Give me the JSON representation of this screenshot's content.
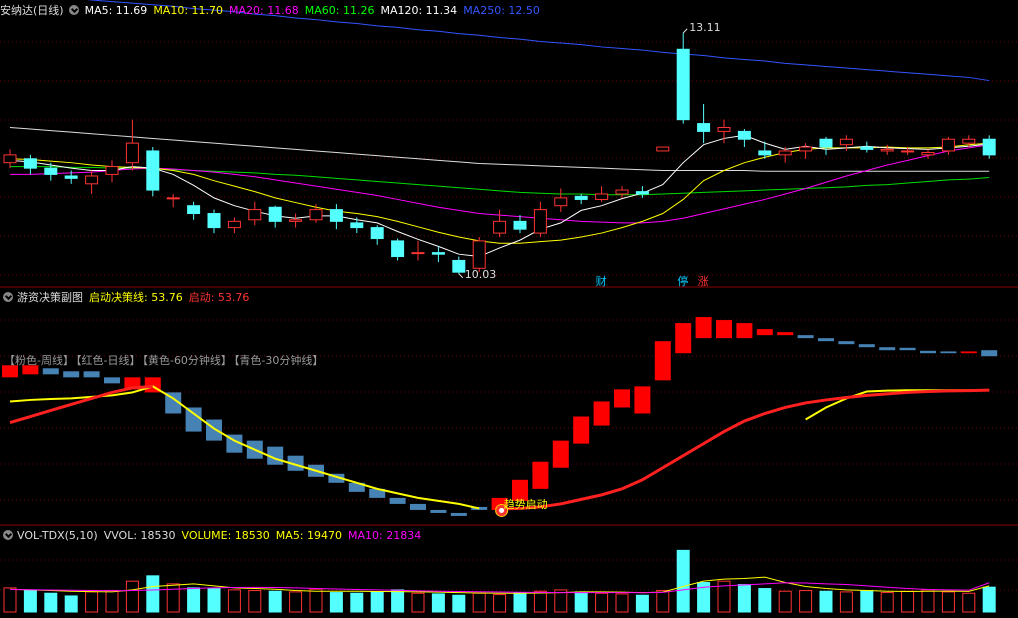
{
  "main": {
    "title": "安纳达(日线)",
    "ma": [
      {
        "label": "MA5: 11.69",
        "color": "#ffffff"
      },
      {
        "label": "MA10: 11.70",
        "color": "#ffff00"
      },
      {
        "label": "MA20: 11.68",
        "color": "#ff00ff"
      },
      {
        "label": "MA60: 11.26",
        "color": "#00ff00"
      },
      {
        "label": "MA120: 11.34",
        "color": "#ffffff"
      },
      {
        "label": "MA250: 12.50",
        "color": "#3355ff"
      }
    ],
    "high_label": "13.11",
    "low_label": "10.03",
    "markers": [
      {
        "text": "财",
        "color": "#00ccff"
      },
      {
        "text": "停",
        "color": "#00ccff"
      },
      {
        "text": "涨",
        "color": "#ff3333"
      }
    ],
    "candles": [
      [
        11.45,
        11.55,
        11.62,
        11.38
      ],
      [
        11.5,
        11.38,
        11.55,
        11.3
      ],
      [
        11.38,
        11.3,
        11.45,
        11.22
      ],
      [
        11.28,
        11.25,
        11.35,
        11.18
      ],
      [
        11.18,
        11.28,
        11.35,
        11.05
      ],
      [
        11.3,
        11.4,
        11.48,
        11.2
      ],
      [
        11.45,
        11.7,
        12.0,
        11.35
      ],
      [
        11.6,
        11.1,
        11.65,
        11.02
      ],
      [
        11.0,
        11.0,
        11.05,
        10.88
      ],
      [
        10.9,
        10.8,
        10.95,
        10.72
      ],
      [
        10.8,
        10.62,
        10.85,
        10.55
      ],
      [
        10.62,
        10.7,
        10.75,
        10.55
      ],
      [
        10.72,
        10.85,
        10.95,
        10.65
      ],
      [
        10.88,
        10.7,
        10.9,
        10.62
      ],
      [
        10.7,
        10.72,
        10.8,
        10.62
      ],
      [
        10.72,
        10.85,
        10.92,
        10.68
      ],
      [
        10.85,
        10.7,
        10.92,
        10.6
      ],
      [
        10.68,
        10.62,
        10.75,
        10.55
      ],
      [
        10.62,
        10.48,
        10.65,
        10.4
      ],
      [
        10.45,
        10.25,
        10.48,
        10.2
      ],
      [
        10.3,
        10.3,
        10.45,
        10.2
      ],
      [
        10.3,
        10.28,
        10.38,
        10.18
      ],
      [
        10.2,
        10.05,
        10.25,
        10.03
      ],
      [
        10.1,
        10.45,
        10.5,
        10.05
      ],
      [
        10.55,
        10.7,
        10.85,
        10.5
      ],
      [
        10.7,
        10.6,
        10.78,
        10.55
      ],
      [
        10.55,
        10.85,
        10.95,
        10.5
      ],
      [
        10.9,
        11.0,
        11.12,
        10.82
      ],
      [
        11.02,
        10.98,
        11.05,
        10.92
      ],
      [
        10.98,
        11.05,
        11.15,
        10.95
      ],
      [
        11.05,
        11.1,
        11.15,
        11.0
      ],
      [
        11.08,
        11.05,
        11.15,
        11.0
      ],
      [
        11.6,
        11.65,
        11.65,
        11.6
      ],
      [
        12.9,
        12.0,
        13.11,
        11.95
      ],
      [
        11.95,
        11.85,
        12.2,
        11.7
      ],
      [
        11.85,
        11.9,
        12.0,
        11.7
      ],
      [
        11.85,
        11.75,
        11.88,
        11.65
      ],
      [
        11.6,
        11.55,
        11.72,
        11.5
      ],
      [
        11.55,
        11.6,
        11.65,
        11.45
      ],
      [
        11.6,
        11.65,
        11.7,
        11.5
      ],
      [
        11.75,
        11.65,
        11.78,
        11.55
      ],
      [
        11.68,
        11.75,
        11.8,
        11.6
      ],
      [
        11.65,
        11.62,
        11.72,
        11.58
      ],
      [
        11.6,
        11.62,
        11.68,
        11.55
      ],
      [
        11.6,
        11.6,
        11.65,
        11.55
      ],
      [
        11.55,
        11.58,
        11.62,
        11.5
      ],
      [
        11.6,
        11.75,
        11.78,
        11.55
      ],
      [
        11.7,
        11.75,
        11.8,
        11.65
      ],
      [
        11.75,
        11.55,
        11.8,
        11.5
      ]
    ],
    "ma5": [
      11.48,
      11.46,
      11.42,
      11.38,
      11.35,
      11.35,
      11.4,
      11.38,
      11.3,
      11.16,
      11.0,
      10.9,
      10.83,
      10.77,
      10.74,
      10.77,
      10.77,
      10.72,
      10.68,
      10.57,
      10.47,
      10.38,
      10.28,
      10.25,
      10.36,
      10.46,
      10.6,
      10.68,
      10.84,
      10.9,
      10.99,
      11.06,
      11.17,
      11.45,
      11.68,
      11.76,
      11.8,
      11.7,
      11.62,
      11.66,
      11.62,
      11.64,
      11.66,
      11.64,
      11.63,
      11.62,
      11.64,
      11.66,
      11.69
    ],
    "ma10": [
      11.5,
      11.49,
      11.47,
      11.45,
      11.42,
      11.4,
      11.39,
      11.38,
      11.35,
      11.3,
      11.22,
      11.15,
      11.08,
      11.0,
      10.94,
      10.88,
      10.83,
      10.8,
      10.76,
      10.7,
      10.63,
      10.56,
      10.5,
      10.45,
      10.42,
      10.42,
      10.44,
      10.46,
      10.5,
      10.55,
      10.62,
      10.7,
      10.8,
      10.98,
      11.22,
      11.35,
      11.45,
      11.52,
      11.58,
      11.62,
      11.64,
      11.64,
      11.64,
      11.65,
      11.64,
      11.64,
      11.65,
      11.68,
      11.7
    ],
    "ma20": [
      11.3,
      11.3,
      11.31,
      11.32,
      11.33,
      11.35,
      11.37,
      11.38,
      11.37,
      11.35,
      11.33,
      11.3,
      11.27,
      11.23,
      11.19,
      11.15,
      11.11,
      11.07,
      11.03,
      10.98,
      10.93,
      10.88,
      10.84,
      10.8,
      10.78,
      10.76,
      10.74,
      10.72,
      10.7,
      10.69,
      10.68,
      10.68,
      10.7,
      10.74,
      10.8,
      10.86,
      10.92,
      10.98,
      11.05,
      11.12,
      11.2,
      11.28,
      11.35,
      11.42,
      11.48,
      11.54,
      11.6,
      11.64,
      11.68
    ],
    "ma60": [
      11.4,
      11.4,
      11.4,
      11.39,
      11.39,
      11.38,
      11.38,
      11.37,
      11.36,
      11.35,
      11.34,
      11.33,
      11.32,
      11.3,
      11.29,
      11.27,
      11.25,
      11.23,
      11.21,
      11.19,
      11.17,
      11.15,
      11.13,
      11.11,
      11.09,
      11.07,
      11.06,
      11.05,
      11.05,
      11.04,
      11.04,
      11.04,
      11.05,
      11.06,
      11.07,
      11.08,
      11.09,
      11.1,
      11.11,
      11.12,
      11.13,
      11.14,
      11.16,
      11.17,
      11.19,
      11.21,
      11.23,
      11.24,
      11.26
    ],
    "ma120": [
      11.9,
      11.88,
      11.86,
      11.84,
      11.82,
      11.8,
      11.78,
      11.76,
      11.74,
      11.72,
      11.7,
      11.68,
      11.66,
      11.64,
      11.62,
      11.6,
      11.58,
      11.56,
      11.54,
      11.52,
      11.5,
      11.48,
      11.46,
      11.44,
      11.43,
      11.42,
      11.41,
      11.4,
      11.39,
      11.38,
      11.37,
      11.36,
      11.35,
      11.35,
      11.35,
      11.35,
      11.35,
      11.34,
      11.34,
      11.34,
      11.34,
      11.34,
      11.34,
      11.34,
      11.34,
      11.34,
      11.34,
      11.34,
      11.34
    ],
    "ma250": [
      13.62,
      13.6,
      13.58,
      13.56,
      13.53,
      13.51,
      13.49,
      13.47,
      13.45,
      13.42,
      13.4,
      13.38,
      13.35,
      13.33,
      13.3,
      13.28,
      13.25,
      13.23,
      13.2,
      13.18,
      13.15,
      13.13,
      13.1,
      13.08,
      13.05,
      13.03,
      13.0,
      12.98,
      12.96,
      12.93,
      12.91,
      12.89,
      12.86,
      12.84,
      12.82,
      12.79,
      12.77,
      12.75,
      12.72,
      12.7,
      12.68,
      12.66,
      12.64,
      12.62,
      12.6,
      12.58,
      12.56,
      12.54,
      12.5
    ]
  },
  "sub": {
    "title": "游资决策副图",
    "line1": {
      "label": "启动决策线: 53.76",
      "color": "#ffff00"
    },
    "line2": {
      "label": "启动: 53.76",
      "color": "#ff3333"
    },
    "legend": [
      "【粉色-周线】",
      "【红色-日线】",
      "【黄色-60分钟线】",
      "【青色-30分钟线】"
    ],
    "signal_text": "趋势启动",
    "bars": [
      [
        58,
        62,
        "r"
      ],
      [
        59,
        62,
        "r"
      ],
      [
        59,
        61,
        "b"
      ],
      [
        58,
        60,
        "b"
      ],
      [
        58,
        60,
        "b"
      ],
      [
        56,
        58,
        "b"
      ],
      [
        54,
        58,
        "r"
      ],
      [
        53,
        58,
        "r"
      ],
      [
        46,
        53,
        "b"
      ],
      [
        40,
        48,
        "b"
      ],
      [
        37,
        44,
        "b"
      ],
      [
        33,
        39,
        "b"
      ],
      [
        31,
        37,
        "b"
      ],
      [
        29,
        35,
        "b"
      ],
      [
        27,
        32,
        "b"
      ],
      [
        25,
        29,
        "b"
      ],
      [
        23,
        26,
        "b"
      ],
      [
        20,
        23,
        "b"
      ],
      [
        18,
        21,
        "b"
      ],
      [
        16,
        18,
        "b"
      ],
      [
        14,
        16,
        "b"
      ],
      [
        13,
        14,
        "b"
      ],
      [
        12,
        13,
        "b"
      ],
      [
        14,
        15,
        "b"
      ],
      [
        14,
        18,
        "r"
      ],
      [
        17,
        24,
        "r"
      ],
      [
        21,
        30,
        "r"
      ],
      [
        28,
        37,
        "r"
      ],
      [
        36,
        45,
        "r"
      ],
      [
        42,
        50,
        "r"
      ],
      [
        48,
        54,
        "r"
      ],
      [
        46,
        55,
        "r"
      ],
      [
        57,
        70,
        "r"
      ],
      [
        66,
        76,
        "r"
      ],
      [
        71,
        78,
        "r"
      ],
      [
        71,
        77,
        "r"
      ],
      [
        71,
        76,
        "r"
      ],
      [
        72,
        74,
        "r"
      ],
      [
        72,
        73,
        "r"
      ],
      [
        71,
        72,
        "b"
      ],
      [
        70,
        71,
        "b"
      ],
      [
        69,
        70,
        "b"
      ],
      [
        68,
        69,
        "b"
      ],
      [
        67,
        68,
        "b"
      ],
      [
        67,
        67.8,
        "b"
      ],
      [
        66,
        66.8,
        "b"
      ],
      [
        66,
        66.6,
        "b"
      ],
      [
        66,
        66.6,
        "r"
      ],
      [
        65,
        67,
        "b"
      ]
    ],
    "yellow": [
      50,
      50.5,
      50.8,
      51,
      51.5,
      52,
      53,
      55,
      51,
      46,
      41,
      37,
      34,
      31,
      29,
      27,
      25,
      23,
      21,
      19.5,
      18,
      17,
      16,
      14.5,
      14.5,
      15,
      16,
      17,
      18,
      19,
      20,
      21,
      22,
      23,
      25,
      28,
      32,
      36,
      40,
      44,
      48,
      51,
      53.3,
      53.6,
      53.7,
      53.7,
      53.7,
      53.7,
      53.76
    ],
    "red": [
      43,
      45,
      47,
      49,
      51,
      53,
      54.5,
      55,
      53,
      47,
      41,
      37,
      34,
      31,
      29,
      27,
      25,
      23,
      21,
      19.5,
      18,
      17,
      16,
      14.5,
      14.3,
      14.5,
      15,
      16,
      17.5,
      19,
      21,
      24,
      28,
      32,
      36,
      40,
      43.5,
      46,
      48,
      49.5,
      50.5,
      51.3,
      52,
      52.5,
      53,
      53.3,
      53.5,
      53.6,
      53.76
    ]
  },
  "vol": {
    "title": "VOL-TDX(5,10)",
    "items": [
      {
        "label": "VVOL: 18530",
        "color": "#dddddd"
      },
      {
        "label": "VOLUME: 18530",
        "color": "#ffff00"
      },
      {
        "label": "MA5: 19470",
        "color": "#ffff00"
      },
      {
        "label": "MA10: 21834",
        "color": "#ff00ff"
      }
    ],
    "values": [
      18000,
      16500,
      14000,
      12000,
      15000,
      16000,
      23000,
      27000,
      21000,
      18000,
      17500,
      16500,
      16000,
      15500,
      15000,
      17000,
      14500,
      14000,
      15000,
      16500,
      14000,
      13500,
      12500,
      14000,
      13000,
      14500,
      15500,
      16500,
      15000,
      14000,
      13500,
      12500,
      16000,
      46000,
      22000,
      23000,
      20500,
      17500,
      15500,
      16000,
      15500,
      15000,
      16000,
      14500,
      15500,
      16500,
      15000,
      14000,
      18530
    ],
    "ma5": [
      17000,
      16500,
      16000,
      15500,
      15200,
      15000,
      16500,
      19000,
      20000,
      21000,
      19500,
      18000,
      17500,
      17000,
      16000,
      15500,
      15500,
      15500,
      15300,
      15200,
      15000,
      14800,
      14500,
      14200,
      14000,
      14000,
      14200,
      14500,
      15000,
      15000,
      14800,
      14500,
      14800,
      19000,
      23000,
      24500,
      25000,
      26000,
      22000,
      19000,
      17500,
      16500,
      16000,
      15500,
      15300,
      15500,
      15600,
      15400,
      19470
    ],
    "ma10": [
      16800,
      16600,
      16400,
      16200,
      16000,
      15900,
      16000,
      16400,
      17000,
      17600,
      18000,
      18300,
      18400,
      18300,
      18000,
      17500,
      17200,
      16800,
      16500,
      16200,
      15800,
      15500,
      15300,
      15100,
      14900,
      14700,
      14600,
      14500,
      14500,
      14500,
      14500,
      14400,
      14600,
      16500,
      18500,
      19500,
      20200,
      21000,
      21800,
      21600,
      21000,
      20500,
      19500,
      18500,
      17500,
      16800,
      16500,
      16300,
      21834
    ],
    "max": 50000
  },
  "axis": {
    "price_min": 9.95,
    "price_max": 13.3,
    "sub_min": 10,
    "sub_max": 82
  }
}
